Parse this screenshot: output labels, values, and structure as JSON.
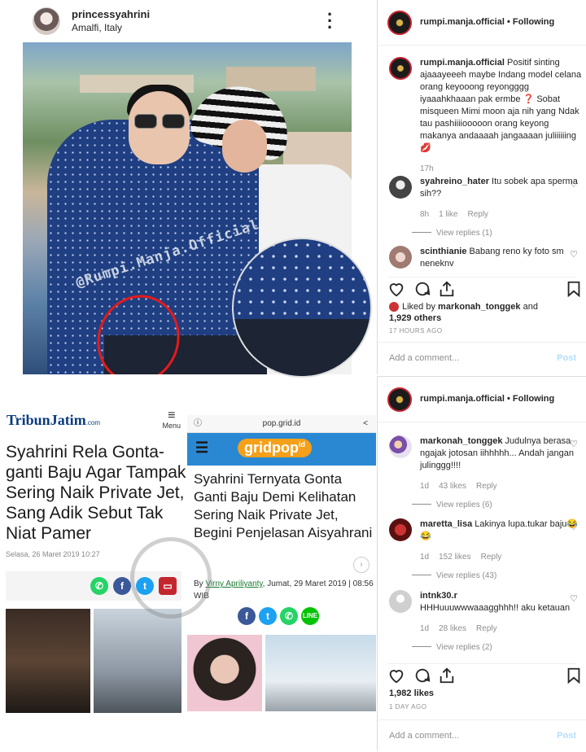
{
  "post_left": {
    "username": "princessyahrini",
    "location": "Amalfi, Italy",
    "watermark": "@Rumpi.Manja.Official"
  },
  "panel1": {
    "account": "rumpi.manja.official",
    "following": "Following",
    "caption_user": "rumpi.manja.official",
    "caption_text": "Positif sinting ajaaayeeeh maybe Indang model celana orang keyooong reyongggg iyaaahkhaaan pak ermbe ❓ Sobat misqueen Mimi moon aja nih yang Ndak tau pashiiiiooooon orang keyong makanya andaaaah jangaaaan juliiiiiing 💋",
    "caption_time": "17h",
    "comments": [
      {
        "user": "syahreino_hater",
        "text": "Itu sobek apa sperma sih??",
        "time": "8h",
        "likes": "1 like",
        "reply": "Reply",
        "view_replies": "View replies (1)"
      },
      {
        "user": "scinthianie",
        "text": "Babang reno ky foto sm neneknv"
      }
    ],
    "liked_by_prefix": "Liked by",
    "liked_by_user": "markonah_tonggek",
    "liked_by_suffix": "and",
    "liked_by_others": "1,929 others",
    "posted": "17 HOURS AGO",
    "add_comment": "Add a comment...",
    "post_btn": "Post"
  },
  "panel2": {
    "account": "rumpi.manja.official",
    "following": "Following",
    "comments": [
      {
        "user": "markonah_tonggek",
        "text": "Judulnya berasa ngajak jotosan iihhhhh... Andah jangan julinggg!!!!",
        "time": "1d",
        "likes": "43 likes",
        "reply": "Reply",
        "view_replies": "View replies (6)"
      },
      {
        "user": "maretta_lisa",
        "text": "Lakinya lupa.tukar baju😂😂",
        "time": "1d",
        "likes": "152 likes",
        "reply": "Reply",
        "view_replies": "View replies (43)"
      },
      {
        "user": "intnk30.r",
        "text": "HHHuuuwwwaaagghhh!! aku ketauan",
        "time": "1d",
        "likes": "28 likes",
        "reply": "Reply",
        "view_replies": "View replies (2)"
      }
    ],
    "likes_total": "1,982 likes",
    "posted": "1 DAY AGO",
    "add_comment": "Add a comment...",
    "post_btn": "Post"
  },
  "tribun": {
    "logo": "TribunJatim",
    "logo_suffix": ".com",
    "menu": "Menu",
    "title": "Syahrini Rela Gonta-ganti Baju Agar Tampak Sering Naik Private Jet, Sang Adik Sebut Tak Niat Pamer",
    "date": "Selasa, 26 Maret 2019 10:27"
  },
  "gridpop": {
    "url": "pop.grid.id",
    "logo": "gridpop",
    "logo_suffix": "id",
    "title": "Syahrini Ternyata Gonta Ganti Baju Demi Kelihatan Sering Naik Private Jet, Begini Penjelasan Aisyahrani",
    "by": "By",
    "author": "Virny Apriliyanty",
    "date": ", Jumat, 29 Maret 2019 | 08:56 WIB"
  },
  "colors": {
    "link_blue": "#b2dffc",
    "muted": "#8e8e8e",
    "red_circle": "#e31b1b",
    "whatsapp": "#25d366",
    "facebook": "#3b5998",
    "twitter": "#1da1f2",
    "line": "#00c300"
  }
}
